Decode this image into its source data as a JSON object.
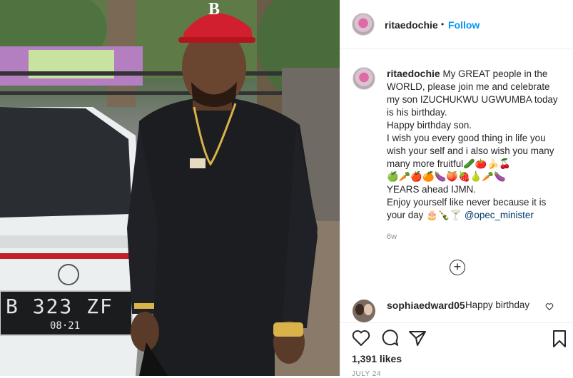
{
  "post": {
    "username": "ritaedochie",
    "follow_label": "Follow",
    "dot": "•",
    "photo": {
      "plate_line1": "B 323 ZF",
      "plate_line2": "08·21",
      "cap_letter": "B"
    },
    "caption": {
      "username": "ritaedochie",
      "text": "My GREAT people in the WORLD, please join me and celebrate my son IZUCHUKWU UGWUMBA today is his birthday.\nHappy birthday son.\nI wish you every good thing in life you wish your self and i also wish you many many more fruitful🥒🍅🍌🍒\n🍏🥕🍎🍊🍆🍑🍓🍐🥕🍆\nYEARS ahead IJMN.\nEnjoy yourself like never because it is your day 🎂🍾🍸 ",
      "mention": "@opec_minister",
      "age": "6w"
    },
    "load_more_icon": "plus-circle-icon",
    "comment": {
      "username": "sophiaedward05",
      "text": "Happy birthday",
      "icon": "heart-icon"
    },
    "likes": "1,391 likes",
    "date": "JULY 24",
    "icons": [
      "heart-icon",
      "comment-icon",
      "share-icon",
      "bookmark-icon"
    ]
  }
}
